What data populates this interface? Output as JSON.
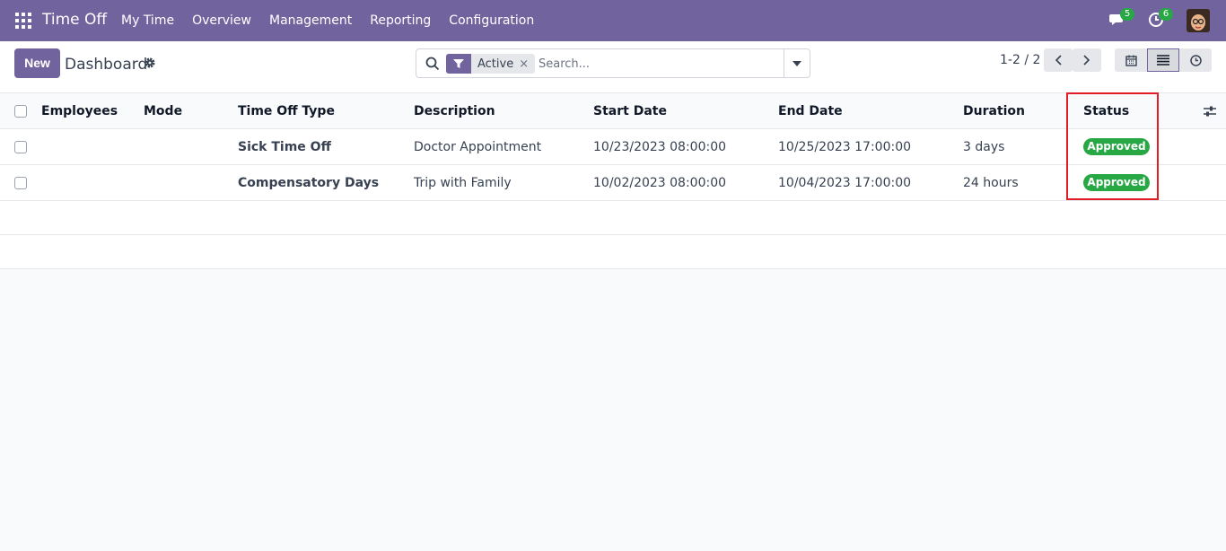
{
  "navbar": {
    "app_title": "Time Off",
    "menu": [
      "My Time",
      "Overview",
      "Management",
      "Reporting",
      "Configuration"
    ],
    "messages_count": "5",
    "activities_count": "6",
    "icons": {
      "apps": "grid-icon",
      "messages": "chat-icon",
      "activities": "clock-icon",
      "user": "avatar"
    }
  },
  "control_panel": {
    "new_label": "New",
    "breadcrumb": "Dashboard",
    "search": {
      "facet": "Active",
      "facet_remove": "×",
      "placeholder": "Search..."
    },
    "pager": "1-2 / 2",
    "views": [
      "calendar-view",
      "list-view",
      "activity-view"
    ],
    "active_view": "list-view"
  },
  "table": {
    "columns": [
      "Employees",
      "Mode",
      "Time Off Type",
      "Description",
      "Start Date",
      "End Date",
      "Duration",
      "Status"
    ],
    "rows": [
      {
        "employee": "",
        "mode": "",
        "type": "Sick Time Off",
        "description": "Doctor Appointment",
        "start": "10/23/2023 08:00:00",
        "end": "10/25/2023 17:00:00",
        "duration": "3 days",
        "status": "Approved"
      },
      {
        "employee": "",
        "mode": "",
        "type": "Compensatory Days",
        "description": "Trip with Family",
        "start": "10/02/2023 08:00:00",
        "end": "10/04/2023 17:00:00",
        "duration": "24 hours",
        "status": "Approved"
      }
    ]
  },
  "colors": {
    "brand": "#71639e",
    "approved": "#28a745",
    "highlight": "#e11d27"
  }
}
